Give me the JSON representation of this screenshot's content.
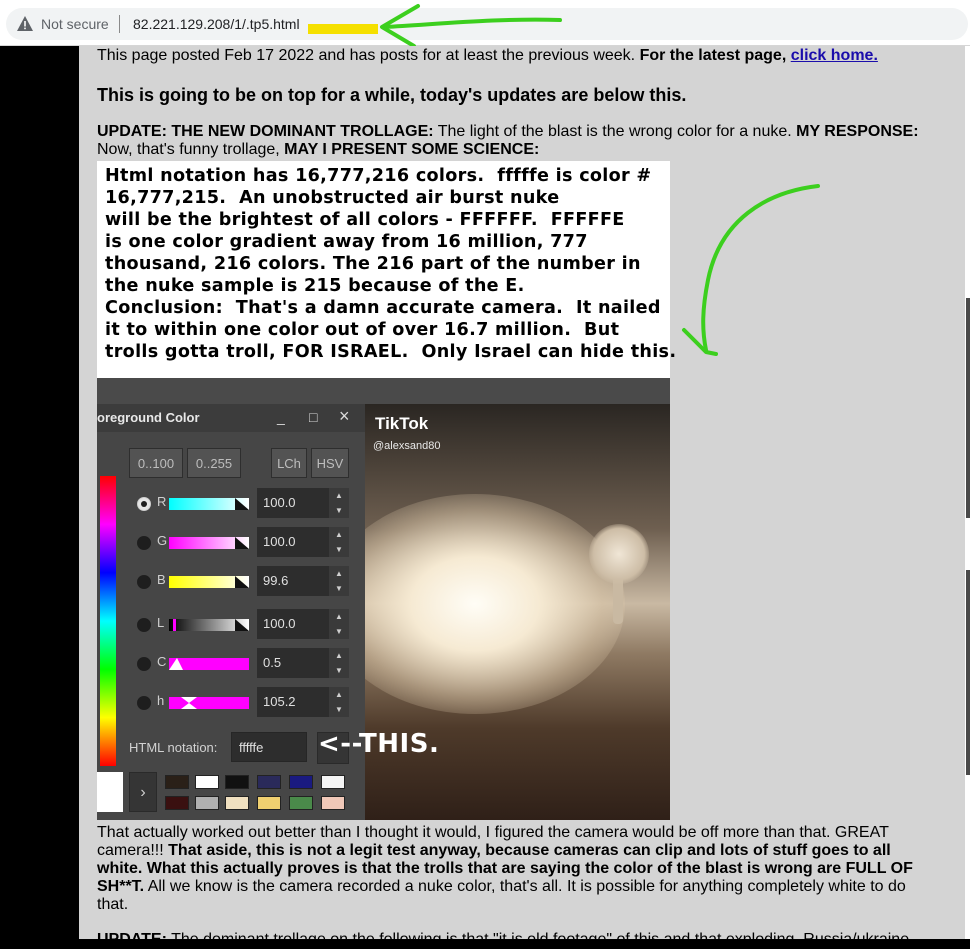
{
  "browser": {
    "security_label": "Not secure",
    "url": "82.221.129.208/1/.tp5.html"
  },
  "page": {
    "posted_text": "This page posted Feb 17 2022 and has posts for at least the previous week.",
    "latest_bold": "For the latest page,",
    "home_link": "click home.",
    "ontop": "This is going to be on top for a while, today's updates are below this.",
    "update1_label": "UPDATE: THE NEW DOMINANT TROLLAGE:",
    "update1_text": " The light of the blast is the wrong color for a nuke. ",
    "response_label": "MY RESPONSE:",
    "response_text": " Now, that's funny trollage, ",
    "science_label": "MAY I PRESENT SOME SCIENCE:",
    "science_box": "Html notation has 16,777,216 colors.  fffffe is color #\n16,777,215.  An unobstructed air burst nuke\nwill be the brightest of all colors - FFFFFF.  FFFFFE\nis one color gradient away from 16 million, 777\nthousand, 216 colors. The 216 part of the number in\nthe nuke sample is 215 because of the E.\nConclusion:  That's a damn accurate camera.  It nailed\nit to within one color out of over 16.7 million.  But\ntrolls gotta troll, FOR ISRAEL.  Only Israel can hide this.",
    "after_plain1": "That actually worked out better than I thought it would, I figured the camera would be off more than that. GREAT camera!!! ",
    "after_bold": "That aside, this is not a legit test anyway, because cameras can clip and lots of stuff goes to all white. What this actually proves is that the trolls that are saying the color of the blast is wrong are FULL OF SH**T.",
    "after_plain2": " All we know is the camera recorded a nuke color, that's all. It is possible for anything completely white to do that.",
    "update2_label": "UPDATE:",
    "update2_text": " The dominant trollage on the following is that \"it is old footage\" of this and that exploding, Russia/ukraine"
  },
  "dialog": {
    "title": "oreground Color",
    "minimize": "_",
    "maximize": "□",
    "close": "×",
    "mode_buttons": [
      "0..100",
      "0..255",
      "LCh",
      "HSV"
    ],
    "channels": [
      {
        "label": "R",
        "value": "100.0",
        "selected": true
      },
      {
        "label": "G",
        "value": "100.0",
        "selected": false
      },
      {
        "label": "B",
        "value": "99.6",
        "selected": false
      },
      {
        "label": "L",
        "value": "100.0",
        "selected": false
      },
      {
        "label": "C",
        "value": "0.5",
        "selected": false
      },
      {
        "label": "h",
        "value": "105.2",
        "selected": false
      }
    ],
    "html_notation_label": "HTML notation:",
    "html_notation_value": "fffffe",
    "next_glyph": "›",
    "spin_up": "▲",
    "spin_down": "▼"
  },
  "video": {
    "brand": "TikTok",
    "user": "@alexsand80"
  },
  "annotation": {
    "this_label": "<--THIS."
  },
  "colors": {
    "page_bg": "#d4d4d4",
    "link": "#1a0dab",
    "arrow_green": "#3ccf1e",
    "highlight_yellow": "#f5e000"
  }
}
